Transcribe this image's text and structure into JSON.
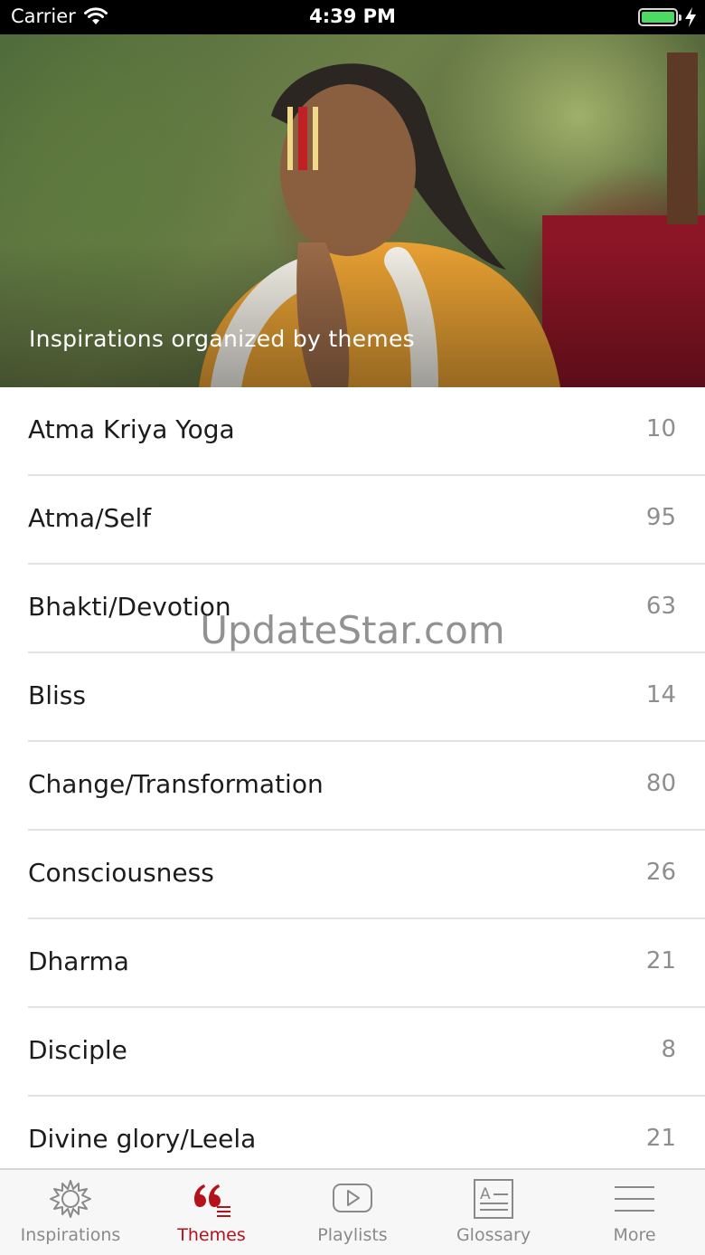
{
  "status_bar": {
    "carrier": "Carrier",
    "time": "4:39 PM"
  },
  "hero": {
    "caption": "Inspirations organized by themes"
  },
  "themes": [
    {
      "name": "Atma Kriya Yoga",
      "count": "10"
    },
    {
      "name": "Atma/Self",
      "count": "95"
    },
    {
      "name": "Bhakti/Devotion",
      "count": "63"
    },
    {
      "name": "Bliss",
      "count": "14"
    },
    {
      "name": "Change/Transformation",
      "count": "80"
    },
    {
      "name": "Consciousness",
      "count": "26"
    },
    {
      "name": "Dharma",
      "count": "21"
    },
    {
      "name": "Disciple",
      "count": "8"
    },
    {
      "name": "Divine glory/Leela",
      "count": "21"
    }
  ],
  "watermark": "UpdateStar.com",
  "tab_bar": {
    "active_color": "#b5121b",
    "inactive_color": "#8a8a8a",
    "tabs": [
      {
        "label": "Inspirations",
        "icon": "sun-icon",
        "active": false
      },
      {
        "label": "Themes",
        "icon": "quote-icon",
        "active": true
      },
      {
        "label": "Playlists",
        "icon": "play-icon",
        "active": false
      },
      {
        "label": "Glossary",
        "icon": "glossary-icon",
        "active": false
      },
      {
        "label": "More",
        "icon": "menu-icon",
        "active": false
      }
    ]
  }
}
